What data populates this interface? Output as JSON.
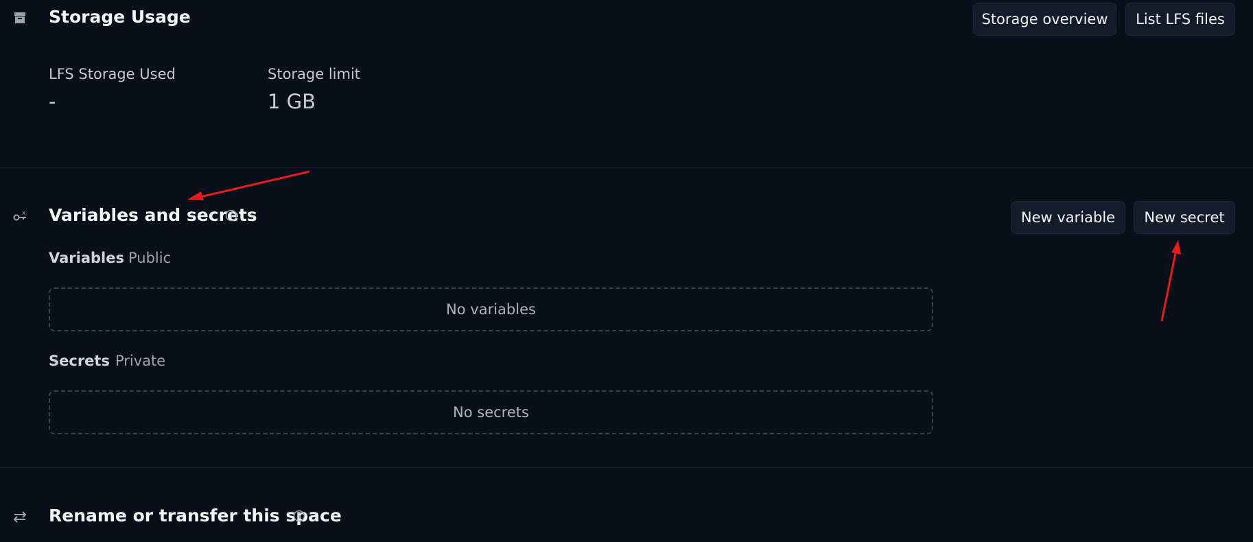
{
  "storage": {
    "title": "Storage Usage",
    "overview_button": "Storage overview",
    "list_lfs_button": "List LFS files",
    "lfs_used_label": "LFS Storage Used",
    "lfs_used_value": "-",
    "limit_label": "Storage limit",
    "limit_value": "1 GB"
  },
  "variables_secrets": {
    "title": "Variables and secrets",
    "new_variable_button": "New variable",
    "new_secret_button": "New secret",
    "variables_label": "Variables",
    "variables_tag": "Public",
    "variables_empty": "No variables",
    "secrets_label": "Secrets",
    "secrets_tag": "Private",
    "secrets_empty": "No secrets"
  },
  "rename": {
    "title": "Rename or transfer this space"
  },
  "icons": {
    "storage": "archive-icon",
    "variables": "key-variable-icon",
    "rename": "transfer-arrows-icon",
    "info": "info-icon"
  },
  "colors": {
    "background": "#0b0f19",
    "button_bg": "#141c2b",
    "annotation_arrow": "#e11d1d"
  }
}
